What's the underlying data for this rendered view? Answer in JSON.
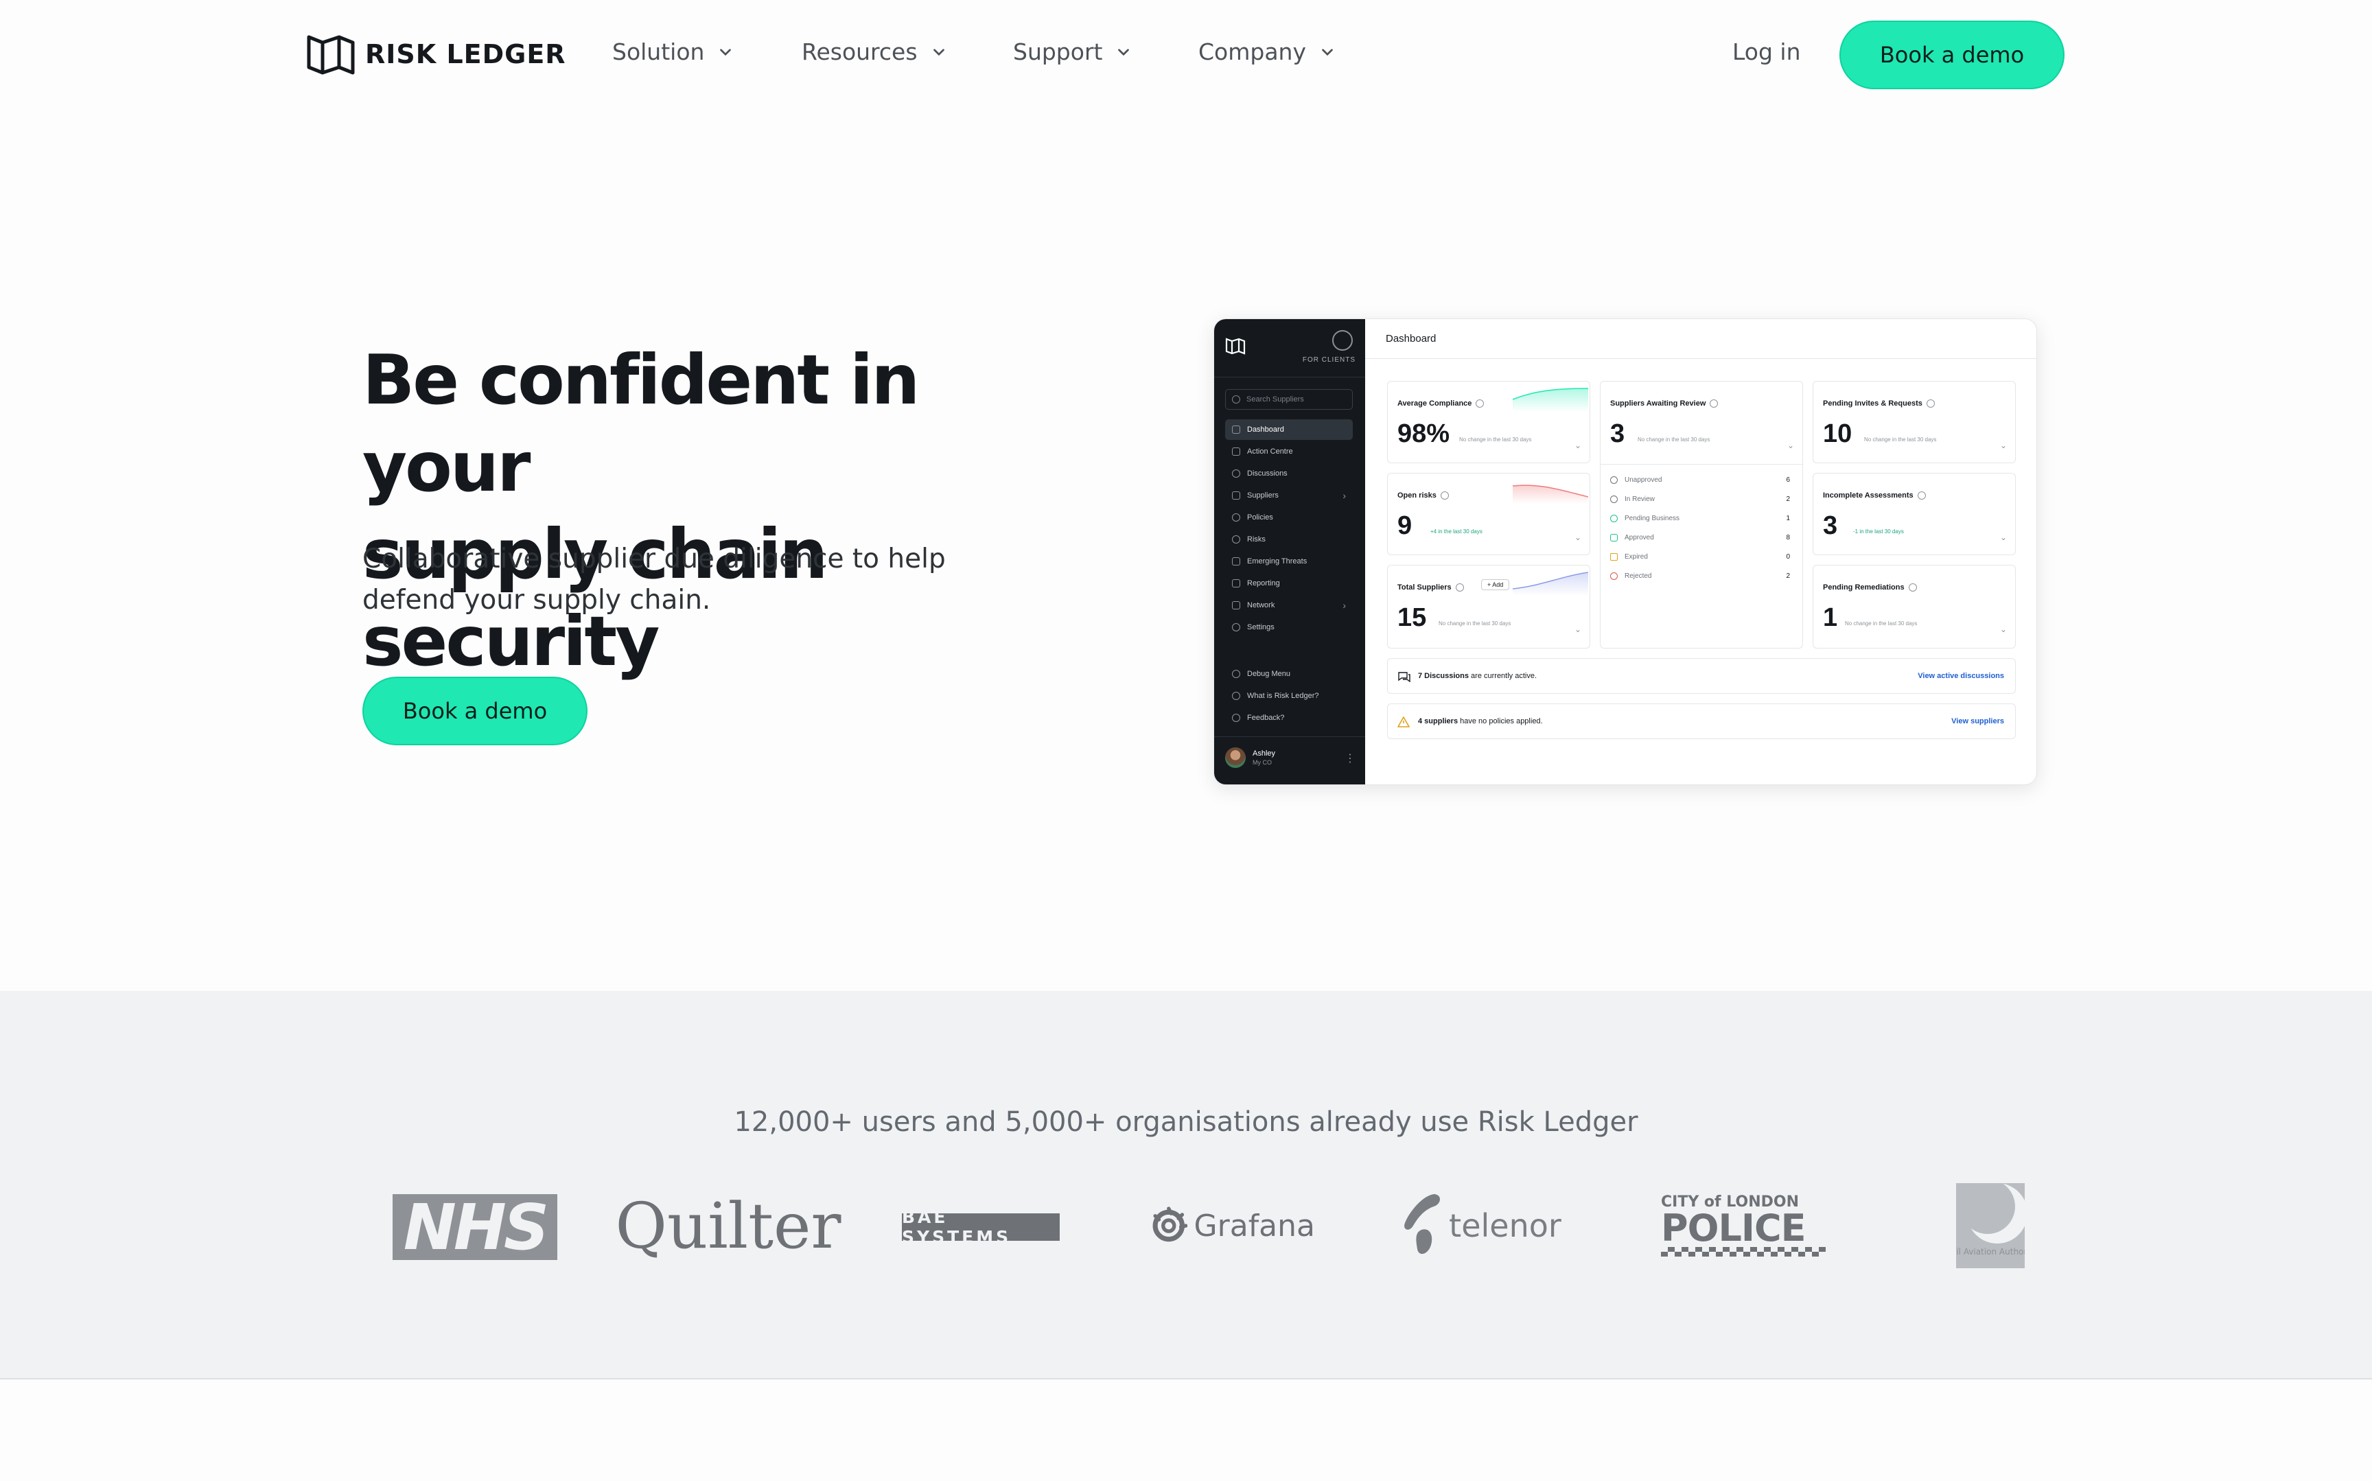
{
  "nav": {
    "brand": "RISK LEDGER",
    "menu": [
      {
        "label": "Solution"
      },
      {
        "label": "Resources"
      },
      {
        "label": "Support"
      },
      {
        "label": "Company"
      }
    ],
    "login": "Log in",
    "cta": "Book a demo"
  },
  "hero": {
    "title_line1": "Be confident in your",
    "title_line2": "supply chain security",
    "subtitle_line1": "Collaborative supplier due diligence to help",
    "subtitle_line2": "defend your supply chain.",
    "cta": "Book a demo"
  },
  "dashboard": {
    "for_clients": "FOR CLIENTS",
    "search_placeholder": "Search Suppliers",
    "title": "Dashboard",
    "sidebar": [
      {
        "label": "Dashboard",
        "active": true
      },
      {
        "label": "Action Centre"
      },
      {
        "label": "Discussions"
      },
      {
        "label": "Suppliers",
        "chevron": true
      },
      {
        "label": "Policies"
      },
      {
        "label": "Risks"
      },
      {
        "label": "Emerging Threats"
      },
      {
        "label": "Reporting"
      },
      {
        "label": "Network",
        "chevron": true
      },
      {
        "label": "Settings"
      }
    ],
    "sidebar_footer": [
      {
        "label": "Debug Menu"
      },
      {
        "label": "What is Risk Ledger?"
      },
      {
        "label": "Feedback?"
      }
    ],
    "user": {
      "name": "Ashley",
      "role": "My CO"
    },
    "cards": {
      "avg_compliance": {
        "label": "Average Compliance",
        "value": "98%",
        "note": "No change in the last 30 days"
      },
      "awaiting_review": {
        "label": "Suppliers Awaiting Review",
        "value": "3",
        "note": "No change in the last 30 days"
      },
      "pending_invites": {
        "label": "Pending Invites & Requests",
        "value": "10",
        "note": "No change in the last 30 days"
      },
      "open_risks": {
        "label": "Open risks",
        "value": "9",
        "note": "+4 in the last 30 days"
      },
      "incomplete_assessments": {
        "label": "Incomplete Assessments",
        "value": "3",
        "note": "-1 in the last 30 days"
      },
      "total_suppliers": {
        "label": "Total Suppliers",
        "value": "15",
        "note": "No change in the last 30 days",
        "add": "+ Add"
      },
      "pending_remediations": {
        "label": "Pending Remediations",
        "value": "1",
        "note": "No change in the last 30 days"
      }
    },
    "statuses": [
      {
        "label": "Unapproved",
        "count": "6"
      },
      {
        "label": "In Review",
        "count": "2"
      },
      {
        "label": "Pending Business",
        "count": "1"
      },
      {
        "label": "Approved",
        "count": "8"
      },
      {
        "label": "Expired",
        "count": "0"
      },
      {
        "label": "Rejected",
        "count": "2"
      }
    ],
    "discussions": {
      "bold": "7 Discussions",
      "text": " are currently active.",
      "link": "View active discussions"
    },
    "policies": {
      "bold": "4 suppliers",
      "text": " have no policies applied.",
      "link": "View suppliers"
    }
  },
  "clients": {
    "tagline": "12,000+ users and 5,000+ organisations already use Risk Ledger",
    "logos": {
      "nhs": "NHS",
      "quilter": "Quilter",
      "bae": "BAE SYSTEMS",
      "grafana": "Grafana",
      "telenor": "telenor",
      "police_top": "CITY of LONDON",
      "police_bottom": "POLICE",
      "caa": "Civil Aviation Authority"
    }
  },
  "colors": {
    "accent": "#1fe8b2",
    "text": "#15191e",
    "band": "#f1f2f4",
    "sidebar": "#15191e"
  }
}
